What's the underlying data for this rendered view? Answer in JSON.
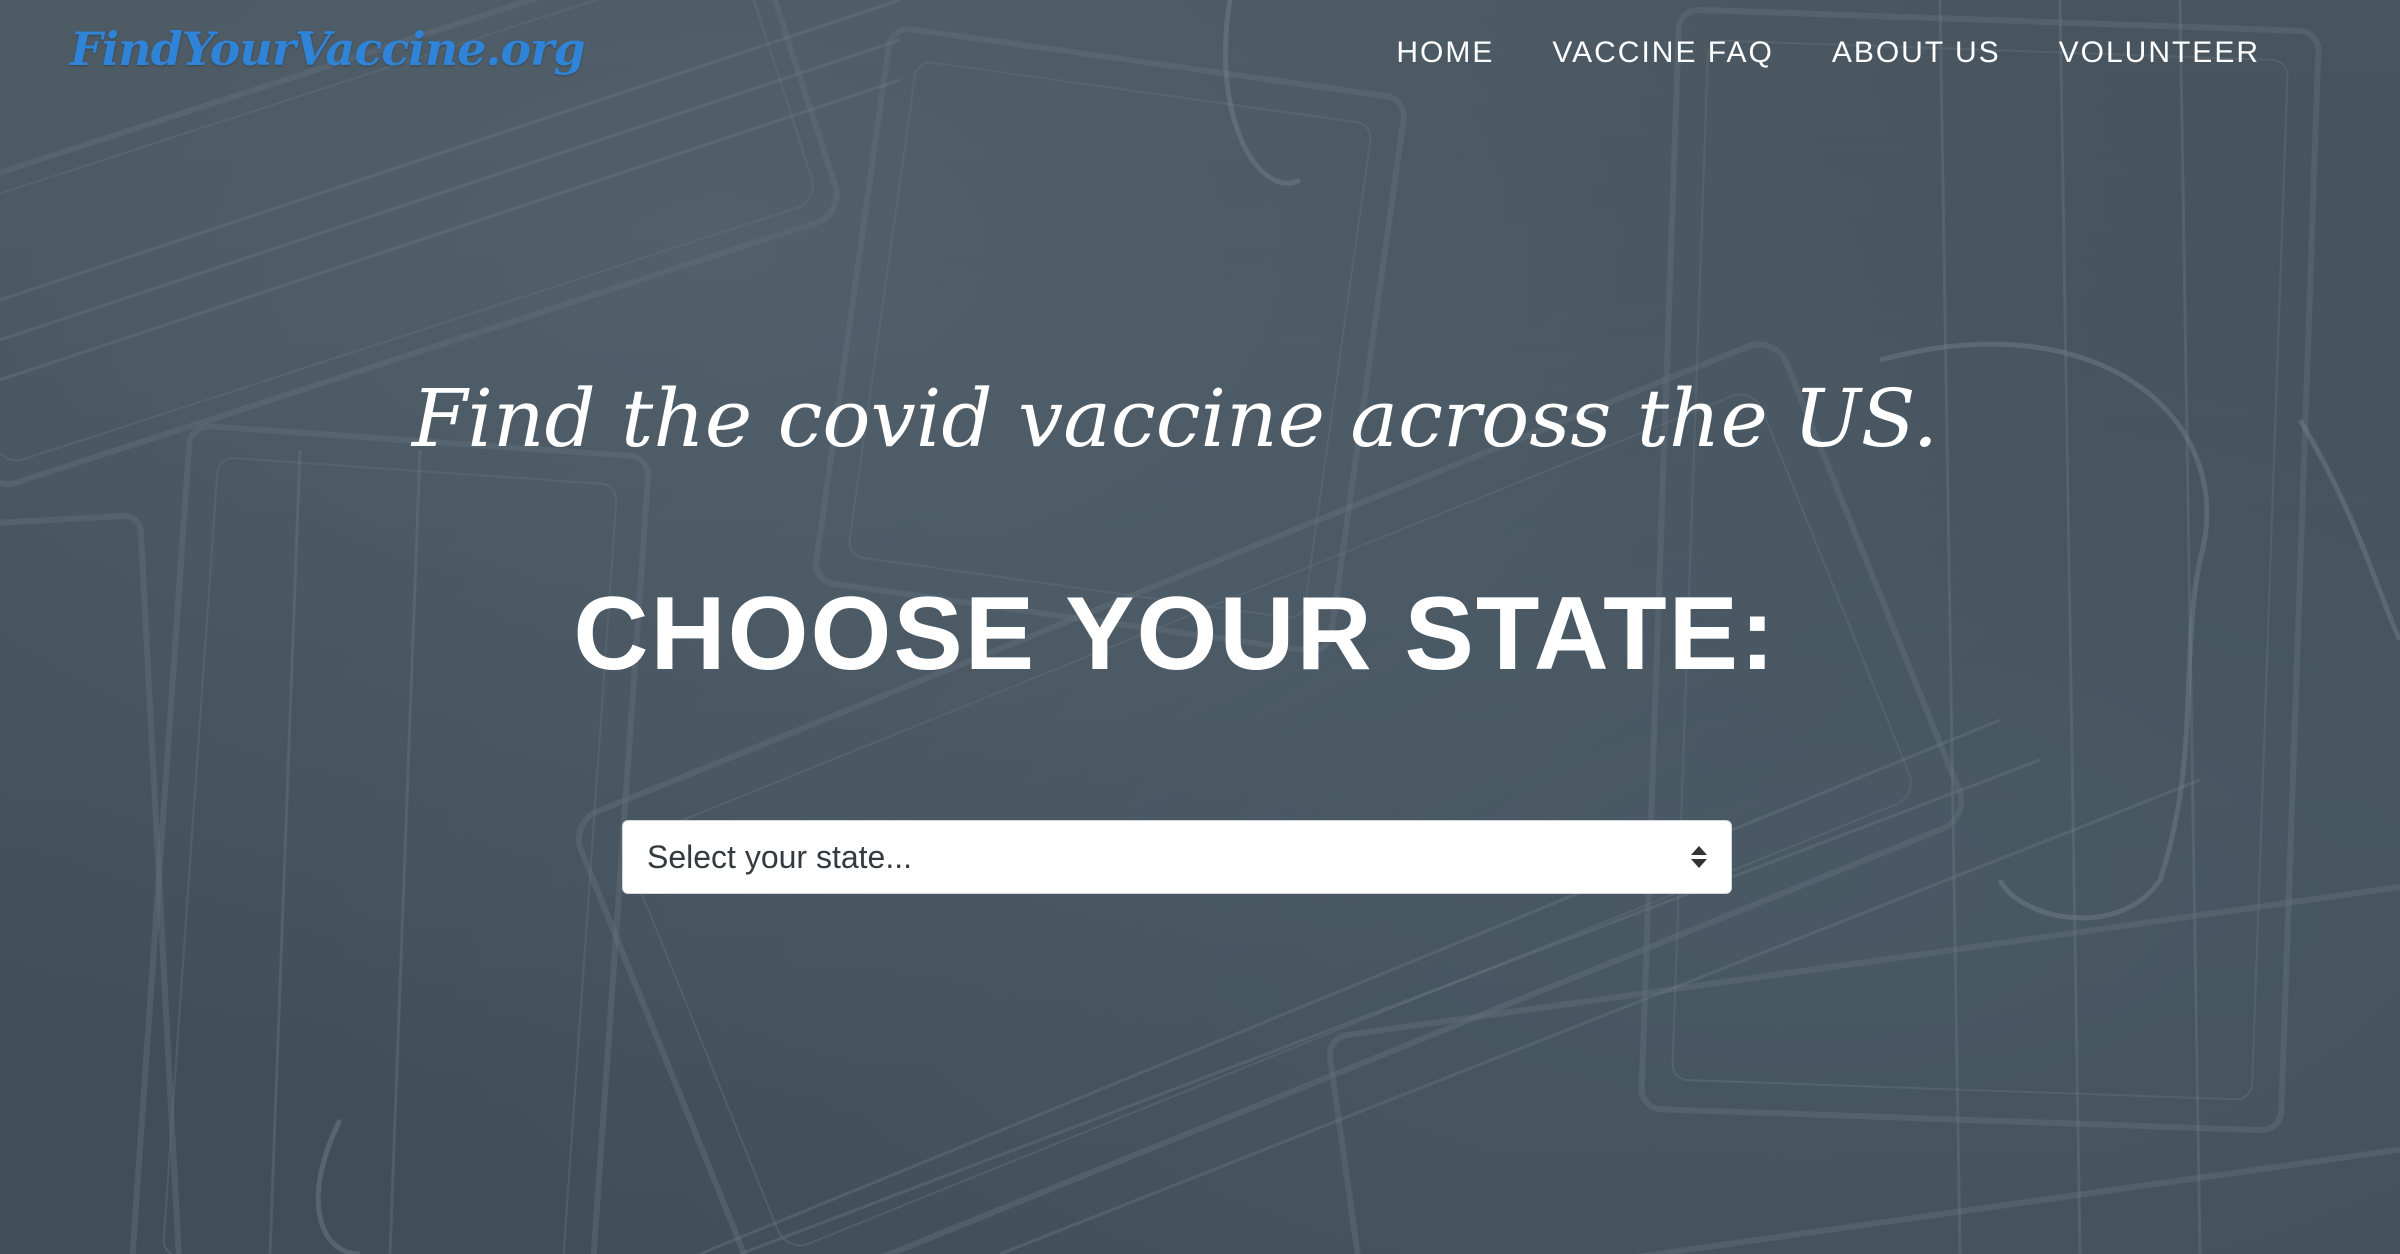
{
  "header": {
    "logo_text": "FindYourVaccine.org",
    "nav": [
      {
        "label": "HOME"
      },
      {
        "label": "VACCINE FAQ"
      },
      {
        "label": "ABOUT US"
      },
      {
        "label": "VOLUNTEER"
      }
    ]
  },
  "hero": {
    "tagline": "Find the covid vaccine across the US.",
    "heading": "CHOOSE YOUR STATE:",
    "state_select": {
      "value": "Select your state...",
      "icon": "select-arrows-icon"
    },
    "background": "surgical-masks-photo"
  },
  "colors": {
    "logo": "#2f84d8",
    "text": "#ffffff",
    "select_bg": "#ffffff"
  }
}
